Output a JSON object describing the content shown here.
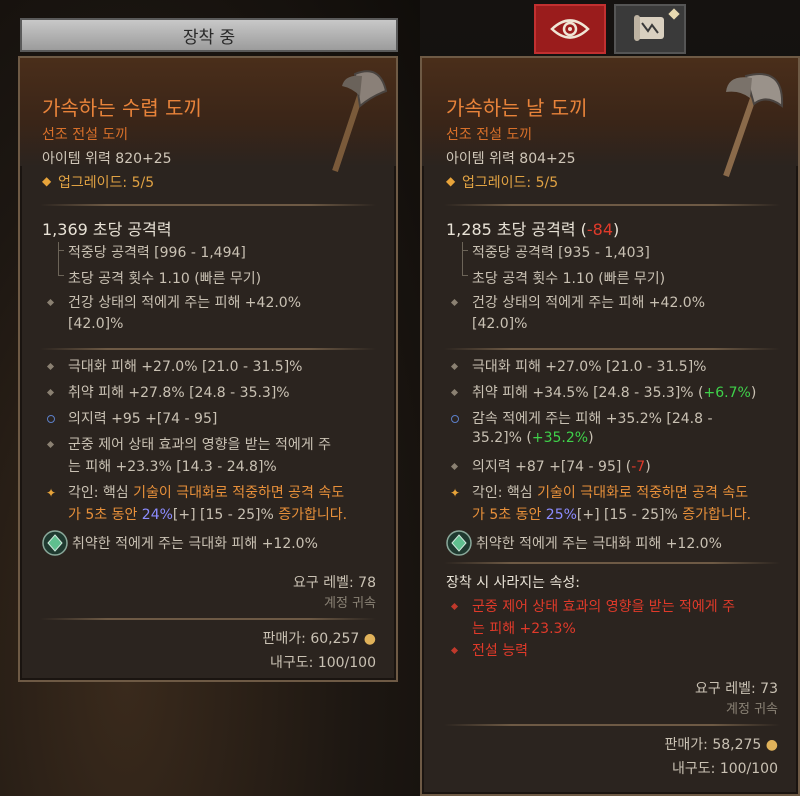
{
  "header": {
    "equipped_tab": "장착 중",
    "eye_icon": "eye-icon",
    "map_icon": "scroll-map-icon"
  },
  "left": {
    "name": "가속하는 수렵 도끼",
    "rarity": "선조 전설 도끼",
    "item_power": "아이템 위력 820+25",
    "upgrade": "업그레이드: 5/5",
    "dps": "1,369 초당 공격력",
    "damage_per_hit": "적중당 공격력 [996 - 1,494]",
    "attacks_per_second": "초당 공격 횟수 1.10 (빠른 무기)",
    "implicit_1": "건강 상태의 적에게 주는 피해 +42.0%",
    "implicit_1b": "[42.0]%",
    "affix_1": "극대화 피해 +27.0% [21.0 - 31.5]%",
    "affix_2": "취약 피해 +27.8% [24.8 - 35.3]%",
    "affix_3": "의지력 +95 +[74 - 95]",
    "affix_4a": "군중 제어 상태 효과의 영향을 받는 적에게 주",
    "affix_4b": "는 피해 +23.3% [14.3 - 24.8]%",
    "aspect_prefix": "각인: 핵심 ",
    "aspect_line1": "기술이 극대화로 적중하면 공격 속도",
    "aspect_line2a": "가 5초 동안 ",
    "aspect_value": "24%",
    "aspect_line2b": "[+] [15 - 25]% ",
    "aspect_line2c": "증가합니다.",
    "socket": "취약한 적에게 주는 극대화 피해 +12.0%",
    "req_level": "요구 레벨: 78",
    "account_bound": "계정 귀속",
    "sell_value": "판매가: 60,257",
    "durability": "내구도: 100/100"
  },
  "right": {
    "name": "가속하는 날 도끼",
    "rarity": "선조 전설 도끼",
    "item_power": "아이템 위력 804+25",
    "upgrade": "업그레이드: 5/5",
    "dps": "1,285 초당 공격력",
    "dps_diff_open": " (",
    "dps_diff": "-84",
    "dps_diff_close": ")",
    "damage_per_hit": "적중당 공격력 [935 - 1,403]",
    "attacks_per_second": "초당 공격 횟수 1.10 (빠른 무기)",
    "implicit_1": "건강 상태의 적에게 주는 피해 +42.0%",
    "implicit_1b": "[42.0]%",
    "affix_1": "극대화 피해 +27.0% [21.0 - 31.5]%",
    "affix_2": "취약 피해 +34.5% [24.8 - 35.3]% (",
    "affix_2_diff": "+6.7%",
    "affix_3a": "감속 적에게 주는 피해 +35.2% [24.8 -",
    "affix_3b": "35.2]% (",
    "affix_3_diff": "+35.2%",
    "affix_4": "의지력 +87 +[74 - 95] (",
    "affix_4_diff": "-7",
    "aspect_prefix": "각인: 핵심 ",
    "aspect_line1": "기술이 극대화로 적중하면 공격 속도",
    "aspect_line2a": "가 5초 동안 ",
    "aspect_value": "25%",
    "aspect_line2b": "[+] [15 - 25]% ",
    "aspect_line2c": "증가합니다.",
    "socket": "취약한 적에게 주는 극대화 피해 +12.0%",
    "lost_header": "장착 시 사라지는 속성:",
    "lost_1a": "군중 제어 상태 효과의 영향을 받는 적에게 주",
    "lost_1b": "는 피해 +23.3%",
    "lost_2": "전설 능력",
    "req_level": "요구 레벨: 73",
    "account_bound": "계정 귀속",
    "sell_value": "판매가: 58,275",
    "durability": "내구도: 100/100"
  },
  "colors": {
    "legendary": "#e8833a",
    "gain": "#3fd14a",
    "loss": "#e03a2a",
    "aspect_value": "#8c8cff"
  }
}
